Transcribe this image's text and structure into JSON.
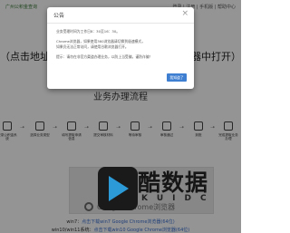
{
  "header": {
    "logo_text": "广州公积金查询",
    "right_links": "登录 | 注册 | 手机版 | 帮助中心"
  },
  "headline": {
    "left": "（点击地址复",
    "right": "览器中打开）"
  },
  "process": {
    "title": "业务办理流程",
    "steps": [
      {
        "label": "登录公积金系统",
        "icon": "login-icon"
      },
      {
        "label": "选择业务类型",
        "icon": "list-icon"
      },
      {
        "label": "填写提取申请信息",
        "icon": "form-icon"
      },
      {
        "label": "提交审核材料",
        "icon": "upload-icon"
      },
      {
        "label": "等待审核",
        "icon": "clock-icon"
      },
      {
        "label": "审核通过",
        "icon": "check-icon"
      },
      {
        "label": "到账",
        "icon": "money-icon"
      },
      {
        "label": "完成提取业务办理",
        "icon": "done-icon"
      }
    ]
  },
  "video": {
    "brand_text": "Google Chrome浏览器"
  },
  "watermark": {
    "title": "酷数据",
    "subtitle": "KUIDC"
  },
  "footer": {
    "line1_prefix": "win7：",
    "line1_link": "点击下载win7 Google Chrome浏览器(64位)",
    "line2_prefix": "win10/win11系统：",
    "line2_link": "点击下载win10 Google Chrome浏览器(64位)"
  },
  "modal": {
    "title": "公告",
    "close_symbol": "×",
    "lines": [
      "业务受理时间为工作日8：30至16：30。",
      "Chrome浏览器，如果使用360浏览器请切换到极速模式，",
      "如果仍无法正常访问，请使用谷歌浏览器打开。",
      "提示：请勿在非官方渠道办理业务，以防上当受骗，谨防诈骗！"
    ],
    "button_label": "我知道了"
  }
}
